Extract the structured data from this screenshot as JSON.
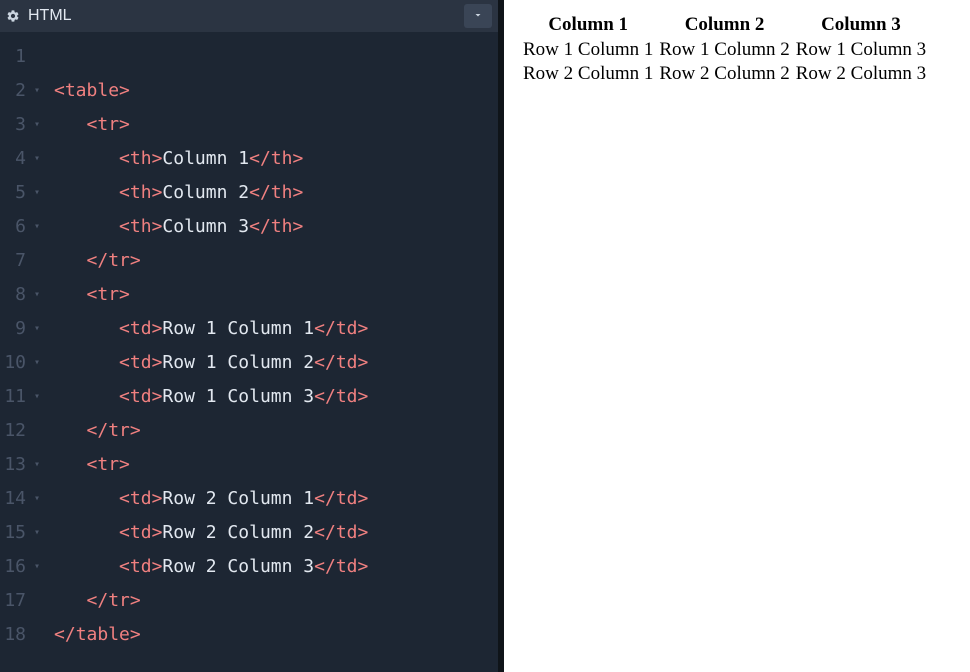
{
  "editor": {
    "title": "HTML",
    "lines": [
      {
        "num": "1",
        "fold": "",
        "indent": 0,
        "parts": []
      },
      {
        "num": "2",
        "fold": "▾",
        "indent": 0,
        "parts": [
          {
            "t": "open",
            "tag": "table"
          }
        ]
      },
      {
        "num": "3",
        "fold": "▾",
        "indent": 1,
        "parts": [
          {
            "t": "open",
            "tag": "tr"
          }
        ]
      },
      {
        "num": "4",
        "fold": "▾",
        "indent": 2,
        "parts": [
          {
            "t": "open",
            "tag": "th"
          },
          {
            "t": "text",
            "val": "Column 1"
          },
          {
            "t": "close",
            "tag": "th"
          }
        ]
      },
      {
        "num": "5",
        "fold": "▾",
        "indent": 2,
        "parts": [
          {
            "t": "open",
            "tag": "th"
          },
          {
            "t": "text",
            "val": "Column 2"
          },
          {
            "t": "close",
            "tag": "th"
          }
        ]
      },
      {
        "num": "6",
        "fold": "▾",
        "indent": 2,
        "parts": [
          {
            "t": "open",
            "tag": "th"
          },
          {
            "t": "text",
            "val": "Column 3"
          },
          {
            "t": "close",
            "tag": "th"
          }
        ]
      },
      {
        "num": "7",
        "fold": "",
        "indent": 1,
        "parts": [
          {
            "t": "close",
            "tag": "tr"
          }
        ]
      },
      {
        "num": "8",
        "fold": "▾",
        "indent": 1,
        "parts": [
          {
            "t": "open",
            "tag": "tr"
          }
        ]
      },
      {
        "num": "9",
        "fold": "▾",
        "indent": 2,
        "parts": [
          {
            "t": "open",
            "tag": "td"
          },
          {
            "t": "text",
            "val": "Row 1 Column 1"
          },
          {
            "t": "close",
            "tag": "td"
          }
        ]
      },
      {
        "num": "10",
        "fold": "▾",
        "indent": 2,
        "parts": [
          {
            "t": "open",
            "tag": "td"
          },
          {
            "t": "text",
            "val": "Row 1 Column 2"
          },
          {
            "t": "close",
            "tag": "td"
          }
        ]
      },
      {
        "num": "11",
        "fold": "▾",
        "indent": 2,
        "parts": [
          {
            "t": "open",
            "tag": "td"
          },
          {
            "t": "text",
            "val": "Row 1 Column 3"
          },
          {
            "t": "close",
            "tag": "td"
          }
        ]
      },
      {
        "num": "12",
        "fold": "",
        "indent": 1,
        "parts": [
          {
            "t": "close",
            "tag": "tr"
          }
        ]
      },
      {
        "num": "13",
        "fold": "▾",
        "indent": 1,
        "parts": [
          {
            "t": "open",
            "tag": "tr"
          }
        ]
      },
      {
        "num": "14",
        "fold": "▾",
        "indent": 2,
        "parts": [
          {
            "t": "open",
            "tag": "td"
          },
          {
            "t": "text",
            "val": "Row 2 Column 1"
          },
          {
            "t": "close",
            "tag": "td"
          }
        ]
      },
      {
        "num": "15",
        "fold": "▾",
        "indent": 2,
        "parts": [
          {
            "t": "open",
            "tag": "td"
          },
          {
            "t": "text",
            "val": "Row 2 Column 2"
          },
          {
            "t": "close",
            "tag": "td"
          }
        ]
      },
      {
        "num": "16",
        "fold": "▾",
        "indent": 2,
        "parts": [
          {
            "t": "open",
            "tag": "td"
          },
          {
            "t": "text",
            "val": "Row 2 Column 3"
          },
          {
            "t": "close",
            "tag": "td"
          }
        ]
      },
      {
        "num": "17",
        "fold": "",
        "indent": 1,
        "parts": [
          {
            "t": "close",
            "tag": "tr"
          }
        ]
      },
      {
        "num": "18",
        "fold": "",
        "indent": 0,
        "parts": [
          {
            "t": "close",
            "tag": "table"
          }
        ]
      }
    ]
  },
  "preview": {
    "headers": [
      "Column 1",
      "Column 2",
      "Column 3"
    ],
    "rows": [
      [
        "Row 1 Column 1",
        "Row 1 Column 2",
        "Row 1 Column 3"
      ],
      [
        "Row 2 Column 1",
        "Row 2 Column 2",
        "Row 2 Column 3"
      ]
    ]
  }
}
